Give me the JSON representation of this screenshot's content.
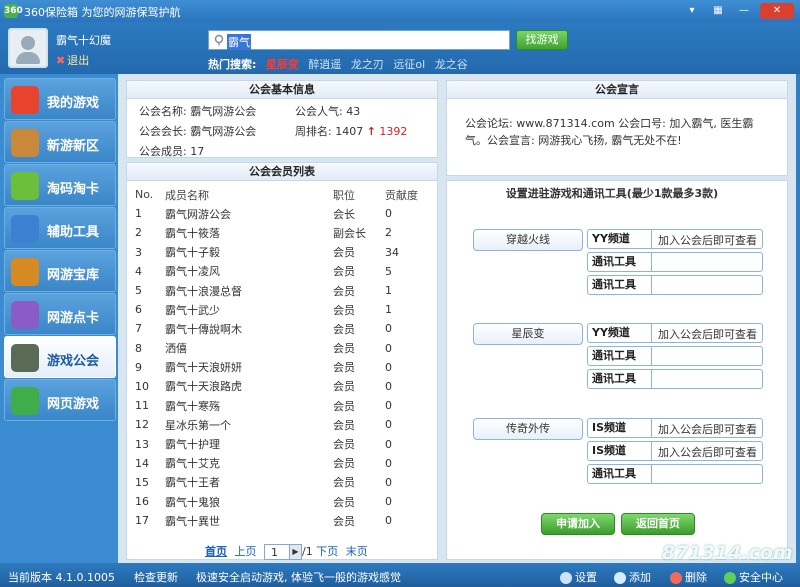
{
  "window": {
    "title": "360保险箱 为您的网游保驾护航",
    "logo": "360"
  },
  "header": {
    "username": "霸气十幻魔",
    "logout": "退出",
    "search_value": "霸气",
    "search_button": "找游戏",
    "hot_label": "热门搜索:",
    "hot_keywords": [
      "星辰变",
      "醉逍遥",
      "龙之刃",
      "远征ol",
      "龙之谷"
    ]
  },
  "sidebar": {
    "items": [
      {
        "label": "我的游戏",
        "icon": "game-coin-icon",
        "color": "#e8432d"
      },
      {
        "label": "新游新区",
        "icon": "signpost-icon",
        "color": "#c9883a"
      },
      {
        "label": "淘码淘卡",
        "icon": "basket-icon",
        "color": "#6cbf3a"
      },
      {
        "label": "辅助工具",
        "icon": "tool-window-icon",
        "color": "#3d7fd0"
      },
      {
        "label": "网游宝库",
        "icon": "treasure-chest-icon",
        "color": "#d58a22"
      },
      {
        "label": "网游点卡",
        "icon": "cards-icon",
        "color": "#8a5cc8"
      },
      {
        "label": "游戏公会",
        "icon": "guild-building-icon",
        "color": "#5a6b55"
      },
      {
        "label": "网页游戏",
        "icon": "g-page-icon",
        "color": "#3fae4a"
      }
    ],
    "active_index": 6
  },
  "basic_info": {
    "title": "公会基本信息",
    "name": "公会名称: 霸气网游公会",
    "popularity": "公会人气: 43",
    "leader": "公会会长: 霸气网游公会",
    "weekly_rank": "周排名: 1407",
    "rank_arrow": "↑",
    "rank_change": "1392",
    "members": "公会成员: 17"
  },
  "member_list": {
    "title": "公会会员列表",
    "columns": [
      "No.",
      "成员名称",
      "职位",
      "贡献度"
    ],
    "rows": [
      [
        "1",
        "霸气网游公会",
        "会长",
        "0"
      ],
      [
        "2",
        "霸气十筱落",
        "副会长",
        "2"
      ],
      [
        "3",
        "霸气十子毅",
        "会员",
        "34"
      ],
      [
        "4",
        "霸气十凌风",
        "会员",
        "5"
      ],
      [
        "5",
        "霸气十浪漫总督",
        "会员",
        "1"
      ],
      [
        "6",
        "霸气十武少",
        "会员",
        "1"
      ],
      [
        "7",
        "霸气十傳說啊木",
        "会员",
        "0"
      ],
      [
        "8",
        "洒僖",
        "会员",
        "0"
      ],
      [
        "9",
        "霸气十天浪妍妍",
        "会员",
        "0"
      ],
      [
        "10",
        "霸气十天浪路虎",
        "会员",
        "0"
      ],
      [
        "11",
        "霸气十寒殇",
        "会员",
        "0"
      ],
      [
        "12",
        "星冰乐第一个",
        "会员",
        "0"
      ],
      [
        "13",
        "霸气十护理",
        "会员",
        "0"
      ],
      [
        "14",
        "霸气十艾克",
        "会员",
        "0"
      ],
      [
        "15",
        "霸气十王者",
        "会员",
        "0"
      ],
      [
        "16",
        "霸气十鬼狼",
        "会员",
        "0"
      ],
      [
        "17",
        "霸气十異世",
        "会员",
        "0"
      ]
    ]
  },
  "pager": {
    "first": "首页",
    "prev": "上页",
    "page": "1",
    "total": "/1",
    "next": "下页",
    "last": "末页"
  },
  "announcement": {
    "title": "公会宣言",
    "text": "公会论坛: www.871314.com  公会口号: 加入霸气, 医生霸气。公会宣言: 网游我心飞扬, 霸气无处不在!"
  },
  "tools": {
    "title": "设置进驻游戏和通讯工具(最少1款最多3款)",
    "games": [
      {
        "name": "穿越火线",
        "rows": [
          {
            "label": "YY频道",
            "value": "加入公会后即可查看"
          },
          {
            "label": "通讯工具",
            "value": ""
          },
          {
            "label": "通讯工具",
            "value": ""
          }
        ]
      },
      {
        "name": "星辰变",
        "rows": [
          {
            "label": "YY频道",
            "value": "加入公会后即可查看"
          },
          {
            "label": "通讯工具",
            "value": ""
          },
          {
            "label": "通讯工具",
            "value": ""
          }
        ]
      },
      {
        "name": "传奇外传",
        "rows": [
          {
            "label": "IS频道",
            "value": "加入公会后即可查看"
          },
          {
            "label": "IS频道",
            "value": "加入公会后即可查看"
          },
          {
            "label": "通讯工具",
            "value": ""
          }
        ]
      }
    ],
    "apply_button": "申请加入",
    "back_button": "返回首页"
  },
  "statusbar": {
    "version": "当前版本 4.1.0.1005",
    "check_update": "检查更新",
    "slogan": "极速安全启动游戏, 体验飞一般的游戏感觉",
    "settings": "设置",
    "add": "添加",
    "delete": "删除",
    "security": "安全中心"
  },
  "watermark": "871314.com"
}
